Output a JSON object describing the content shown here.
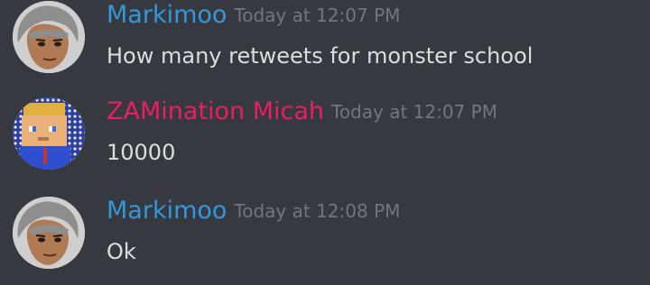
{
  "messages": [
    {
      "author": "Markimoo",
      "author_color": "#3498db",
      "timestamp": "Today at 12:07 PM",
      "text": "How many retweets for monster school",
      "avatar_icon": "cartoon-boy-avatar"
    },
    {
      "author": "ZAMination Micah",
      "author_color": "#e91e63",
      "timestamp": "Today at 12:07 PM",
      "text": "10000",
      "avatar_icon": "blocky-character-avatar"
    },
    {
      "author": "Markimoo",
      "author_color": "#3498db",
      "timestamp": "Today at 12:08 PM",
      "text": "Ok",
      "avatar_icon": "cartoon-boy-avatar"
    }
  ],
  "colors": {
    "background": "#36393f",
    "message_text": "#dcddde",
    "timestamp": "#72767d"
  }
}
